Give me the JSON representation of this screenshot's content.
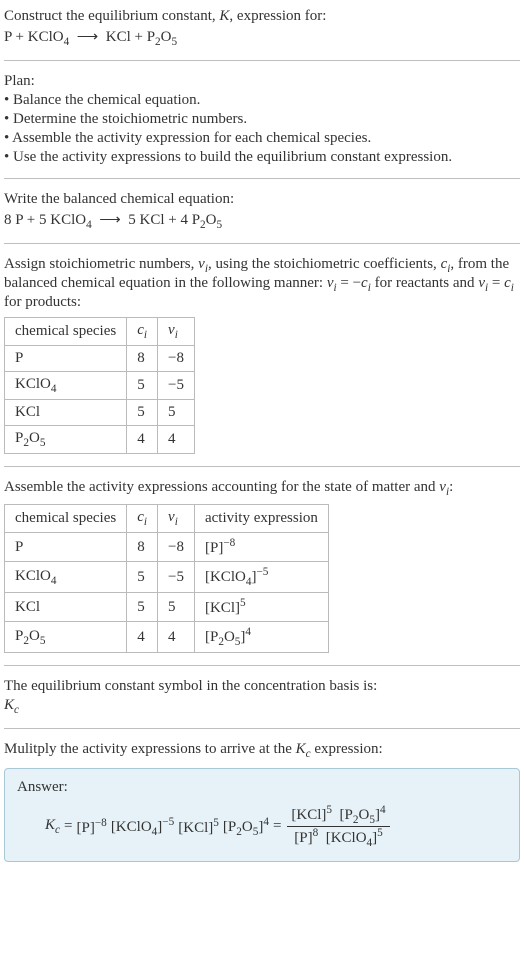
{
  "intro": {
    "line1_a": "Construct the equilibrium constant, ",
    "line1_k": "K",
    "line1_b": ", expression for:",
    "eq_lhs_1": "P + KClO",
    "eq_sub_4": "4",
    "arrow": "⟶",
    "eq_rhs_1": "KCl + P",
    "eq_sub_2": "2",
    "eq_rhs_2": "O",
    "eq_sub_5": "5"
  },
  "plan": {
    "heading": "Plan:",
    "b1": "• Balance the chemical equation.",
    "b2": "• Determine the stoichiometric numbers.",
    "b3": "• Assemble the activity expression for each chemical species.",
    "b4": "• Use the activity expressions to build the equilibrium constant expression."
  },
  "balanced": {
    "heading": "Write the balanced chemical equation:",
    "lhs_a": "8 P + 5 KClO",
    "sub4": "4",
    "arrow": "⟶",
    "rhs_a": "5 KCl + 4 P",
    "sub2": "2",
    "rhs_b": "O",
    "sub5": "5"
  },
  "assign": {
    "text_a": "Assign stoichiometric numbers, ",
    "nu_i": "ν",
    "sub_i": "i",
    "text_b": ", using the stoichiometric coefficients, ",
    "c_i": "c",
    "text_c": ", from the balanced chemical equation in the following manner: ",
    "eq1_a": "ν",
    "eq1_b": " = −",
    "eq1_c": "c",
    "text_d": " for reactants and ",
    "eq2_a": "ν",
    "eq2_b": " = ",
    "eq2_c": "c",
    "text_e": " for products:"
  },
  "table1": {
    "h1": "chemical species",
    "h2": "c",
    "h2sub": "i",
    "h3": "ν",
    "h3sub": "i",
    "rows": [
      {
        "sp": "P",
        "c": "8",
        "nu": "−8",
        "sub": ""
      },
      {
        "sp": "KClO",
        "sub": "4",
        "c": "5",
        "nu": "−5"
      },
      {
        "sp": "KCl",
        "sub": "",
        "c": "5",
        "nu": "5"
      },
      {
        "sp": "P",
        "sub": "2",
        "sp2": "O",
        "sub2": "5",
        "c": "4",
        "nu": "4"
      }
    ]
  },
  "assemble": {
    "text_a": "Assemble the activity expressions accounting for the state of matter and ",
    "nu": "ν",
    "sub_i": "i",
    "text_b": ":"
  },
  "table2": {
    "h1": "chemical species",
    "h2": "c",
    "h2sub": "i",
    "h3": "ν",
    "h3sub": "i",
    "h4": "activity expression",
    "rows": [
      {
        "sp": "P",
        "sub": "",
        "c": "8",
        "nu": "−8",
        "act_base": "[P]",
        "act_exp": "−8"
      },
      {
        "sp": "KClO",
        "sub": "4",
        "c": "5",
        "nu": "−5",
        "act_base": "[KClO",
        "act_sub": "4",
        "act_close": "]",
        "act_exp": "−5"
      },
      {
        "sp": "KCl",
        "sub": "",
        "c": "5",
        "nu": "5",
        "act_base": "[KCl]",
        "act_exp": "5"
      },
      {
        "sp": "P",
        "sub": "2",
        "sp2": "O",
        "sub2": "5",
        "c": "4",
        "nu": "4",
        "act_base": "[P",
        "act_sub": "2",
        "act_mid": "O",
        "act_sub2": "5",
        "act_close": "]",
        "act_exp": "4"
      }
    ]
  },
  "kc_symbol": {
    "line1": "The equilibrium constant symbol in the concentration basis is:",
    "k": "K",
    "sub": "c"
  },
  "multiply": {
    "text_a": "Mulitply the activity expressions to arrive at the ",
    "k": "K",
    "sub": "c",
    "text_b": " expression:"
  },
  "answer": {
    "label": "Answer:",
    "k": "K",
    "ksub": "c",
    "eq": " = ",
    "t1": "[P]",
    "e1": "−8",
    "t2": "[KClO",
    "t2sub": "4",
    "t2close": "]",
    "e2": "−5",
    "t3": "[KCl]",
    "e3": "5",
    "t4": "[P",
    "t4sub": "2",
    "t4mid": "O",
    "t4sub2": "5",
    "t4close": "]",
    "e4": "4",
    "eq2": " = ",
    "num1": "[KCl]",
    "ne1": "5",
    "num2": "[P",
    "n2sub": "2",
    "n2mid": "O",
    "n2sub2": "5",
    "n2close": "]",
    "ne2": "4",
    "den1": "[P]",
    "de1": "8",
    "den2": "[KClO",
    "d2sub": "4",
    "d2close": "]",
    "de2": "5"
  },
  "chart_data": {
    "type": "table",
    "tables": [
      {
        "title": "Stoichiometric numbers",
        "columns": [
          "chemical species",
          "c_i",
          "ν_i"
        ],
        "rows": [
          [
            "P",
            8,
            -8
          ],
          [
            "KClO4",
            5,
            -5
          ],
          [
            "KCl",
            5,
            5
          ],
          [
            "P2O5",
            4,
            4
          ]
        ]
      },
      {
        "title": "Activity expressions",
        "columns": [
          "chemical species",
          "c_i",
          "ν_i",
          "activity expression"
        ],
        "rows": [
          [
            "P",
            8,
            -8,
            "[P]^-8"
          ],
          [
            "KClO4",
            5,
            -5,
            "[KClO4]^-5"
          ],
          [
            "KCl",
            5,
            5,
            "[KCl]^5"
          ],
          [
            "P2O5",
            4,
            4,
            "[P2O5]^4"
          ]
        ]
      }
    ]
  }
}
